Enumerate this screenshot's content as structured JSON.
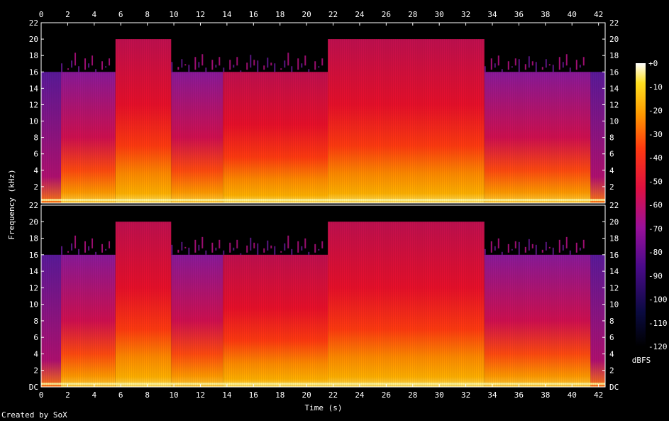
{
  "chart_data": {
    "type": "heatmap",
    "title": "",
    "xlabel": "Time (s)",
    "ylabel": "Frequency (kHz)",
    "x_ticks": [
      "0",
      "2",
      "4",
      "6",
      "8",
      "10",
      "12",
      "14",
      "16",
      "18",
      "20",
      "22",
      "24",
      "26",
      "28",
      "30",
      "32",
      "34",
      "36",
      "38",
      "40",
      "42"
    ],
    "xlim": [
      0,
      42.5
    ],
    "y_ticks_upper": [
      "22",
      "20",
      "18",
      "16",
      "14",
      "12",
      "10",
      "8",
      "6",
      "4",
      "2"
    ],
    "y_ticks_lower": [
      "22",
      "20",
      "18",
      "16",
      "14",
      "12",
      "10",
      "8",
      "6",
      "4",
      "2",
      "DC"
    ],
    "ylim_khz": [
      0,
      22
    ],
    "colorbar": {
      "label": "dBFS",
      "ticks": [
        "+0",
        "-10",
        "-20",
        "-30",
        "-40",
        "-50",
        "-60",
        "-70",
        "-80",
        "-90",
        "-100",
        "-110",
        "-120"
      ],
      "range": [
        -120,
        0
      ]
    },
    "channels": 2,
    "segments": [
      {
        "t_start": 0,
        "t_end": 1.5,
        "cutoff_khz": 16,
        "level": "quiet"
      },
      {
        "t_start": 1.5,
        "t_end": 5.6,
        "cutoff_khz": 16,
        "level": "medium"
      },
      {
        "t_start": 5.6,
        "t_end": 9.8,
        "cutoff_khz": 20,
        "level": "loud"
      },
      {
        "t_start": 9.8,
        "t_end": 13.7,
        "cutoff_khz": 16,
        "level": "medium"
      },
      {
        "t_start": 13.7,
        "t_end": 21.6,
        "cutoff_khz": 16,
        "level": "loud"
      },
      {
        "t_start": 21.6,
        "t_end": 33.4,
        "cutoff_khz": 20,
        "level": "loud"
      },
      {
        "t_start": 33.4,
        "t_end": 41.4,
        "cutoff_khz": 16,
        "level": "medium"
      },
      {
        "t_start": 41.4,
        "t_end": 42.5,
        "cutoff_khz": 16,
        "level": "quiet"
      }
    ]
  },
  "credit": "Created by SoX"
}
